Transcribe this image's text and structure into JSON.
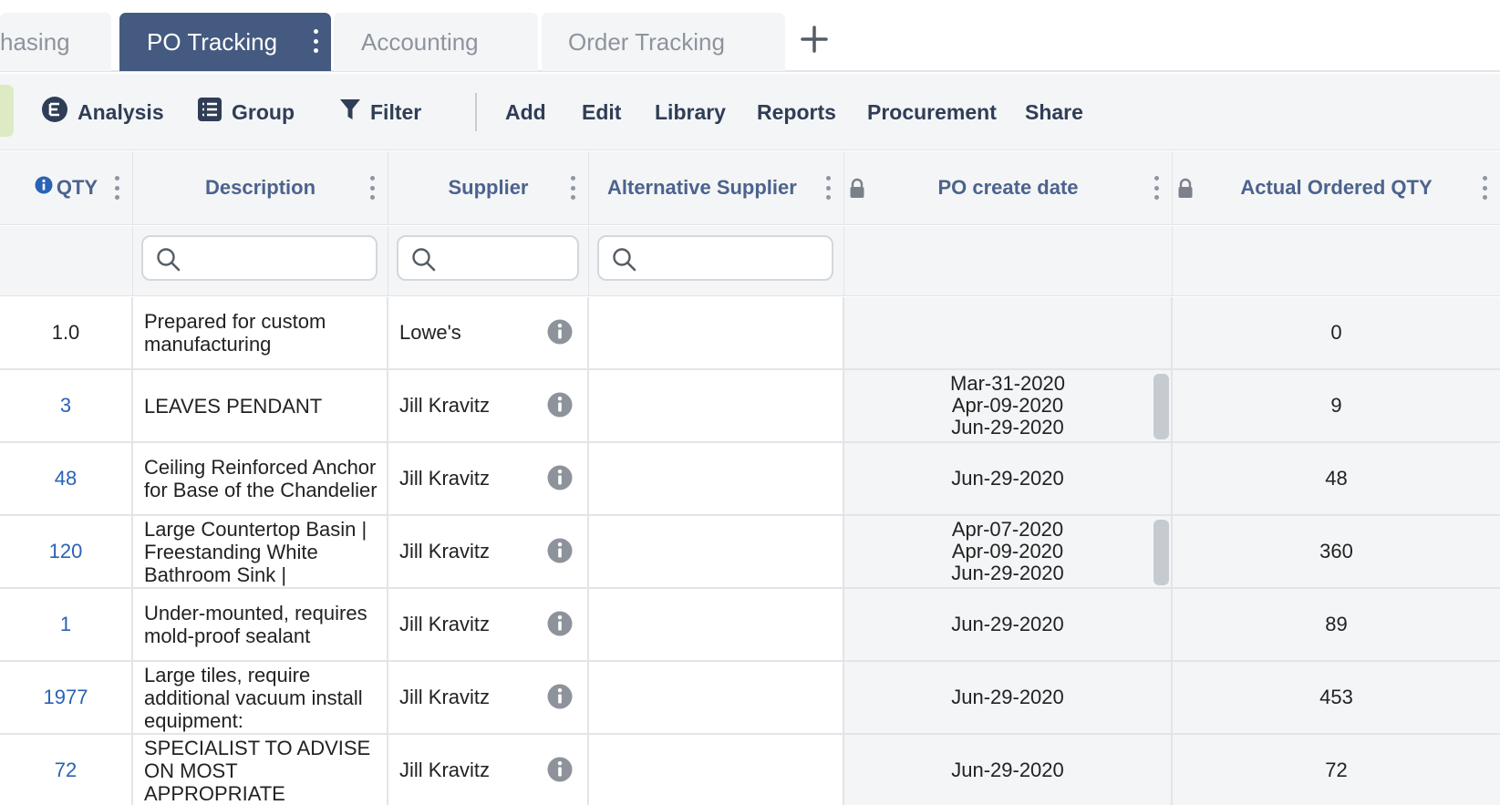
{
  "tabs": [
    {
      "label": "hasing"
    },
    {
      "label": "PO Tracking"
    },
    {
      "label": "Accounting"
    },
    {
      "label": "Order Tracking"
    }
  ],
  "toolbar": {
    "analysis": "Analysis",
    "group": "Group",
    "filter": "Filter",
    "add": "Add",
    "edit": "Edit",
    "library": "Library",
    "reports": "Reports",
    "procurement": "Procurement",
    "share": "Share"
  },
  "columns": {
    "qty": "QTY",
    "description": "Description",
    "supplier": "Supplier",
    "alt_supplier": "Alternative Supplier",
    "po_create_date": "PO create date",
    "actual_qty": "Actual Ordered QTY"
  },
  "search": {
    "placeholder": ""
  },
  "rows": [
    {
      "qty": "1.0",
      "description": "Prepared for custom manufacturing",
      "supplier": "Lowe's",
      "alt_supplier": "",
      "dates": [],
      "actual": "0"
    },
    {
      "qty": "3",
      "description": "LEAVES PENDANT",
      "supplier": "Jill Kravitz",
      "alt_supplier": "",
      "dates": [
        "Mar-31-2020",
        "Apr-09-2020",
        "Jun-29-2020"
      ],
      "actual": "9"
    },
    {
      "qty": "48",
      "description": "Ceiling Reinforced Anchor for Base of the Chandelier",
      "supplier": "Jill Kravitz",
      "alt_supplier": "",
      "dates": [
        "Jun-29-2020"
      ],
      "actual": "48"
    },
    {
      "qty": "120",
      "description": "Large Countertop Basin | Freestanding White Bathroom Sink |",
      "supplier": "Jill Kravitz",
      "alt_supplier": "",
      "dates": [
        "Apr-07-2020",
        "Apr-09-2020",
        "Jun-29-2020"
      ],
      "actual": "360"
    },
    {
      "qty": "1",
      "description": "Under-mounted, requires mold-proof sealant",
      "supplier": "Jill Kravitz",
      "alt_supplier": "",
      "dates": [
        "Jun-29-2020"
      ],
      "actual": "89"
    },
    {
      "qty": "1977",
      "description": "Large tiles, require additional vacuum install equipment:",
      "supplier": "Jill Kravitz",
      "alt_supplier": "",
      "dates": [
        "Jun-29-2020"
      ],
      "actual": "453"
    },
    {
      "qty": "72",
      "description": "SPECIALIST TO ADVISE ON MOST APPROPRIATE",
      "supplier": "Jill Kravitz",
      "alt_supplier": "",
      "dates": [
        "Jun-29-2020"
      ],
      "actual": "72"
    }
  ],
  "colors": {
    "active_tab": "#455a80",
    "header_text": "#4b638e",
    "qty_link": "#2a62b5",
    "toolbar_text": "#2f3d57"
  },
  "icons": {
    "analysis": "analysis-icon",
    "group": "group-icon",
    "filter": "filter-icon",
    "add_tab": "plus-icon",
    "lock": "lock-icon",
    "info": "info-icon",
    "search": "search-icon"
  }
}
